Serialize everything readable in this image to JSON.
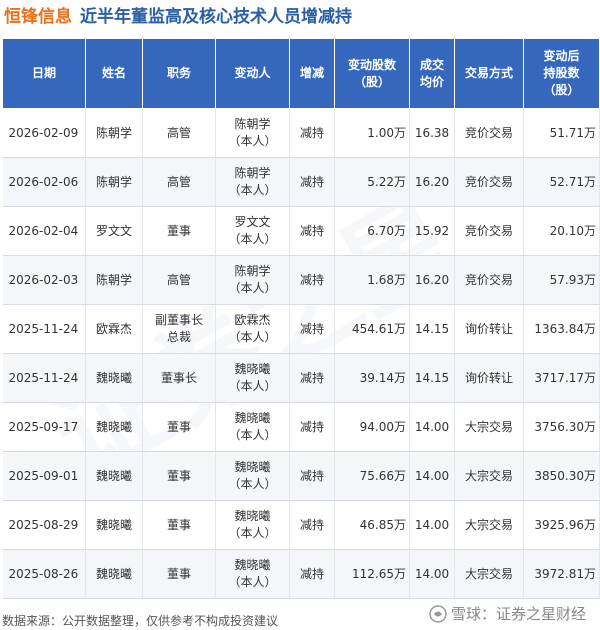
{
  "title": {
    "company": "恒锋信息",
    "text": "近半年董监高及核心技术人员增减持"
  },
  "table": {
    "headers": {
      "date": "日期",
      "name": "姓名",
      "role": "职务",
      "changer": "变动人",
      "change": "增减",
      "amount": "变动股数\n（股）",
      "price": "成交\n均价",
      "method": "交易方式",
      "after": "变动后\n持股数\n（股）"
    },
    "rows": [
      {
        "date": "2026-02-09",
        "name": "陈朝学",
        "role": "高管",
        "changer": "陈朝学\n（本人）",
        "change": "减持",
        "amount": "1.00万",
        "price": "16.38",
        "method": "竞价交易",
        "after": "51.71万"
      },
      {
        "date": "2026-02-06",
        "name": "陈朝学",
        "role": "高管",
        "changer": "陈朝学\n（本人）",
        "change": "减持",
        "amount": "5.22万",
        "price": "16.20",
        "method": "竞价交易",
        "after": "52.71万"
      },
      {
        "date": "2026-02-04",
        "name": "罗文文",
        "role": "董事",
        "changer": "罗文文\n（本人）",
        "change": "减持",
        "amount": "6.70万",
        "price": "15.92",
        "method": "竞价交易",
        "after": "20.10万"
      },
      {
        "date": "2026-02-03",
        "name": "陈朝学",
        "role": "高管",
        "changer": "陈朝学\n（本人）",
        "change": "减持",
        "amount": "1.68万",
        "price": "16.20",
        "method": "竞价交易",
        "after": "57.93万"
      },
      {
        "date": "2025-11-24",
        "name": "欧霖杰",
        "role": "副董事长\n总裁",
        "changer": "欧霖杰\n（本人）",
        "change": "减持",
        "amount": "454.61万",
        "price": "14.15",
        "method": "询价转让",
        "after": "1363.84万"
      },
      {
        "date": "2025-11-24",
        "name": "魏晓曦",
        "role": "董事长",
        "changer": "魏晓曦\n（本人）",
        "change": "减持",
        "amount": "39.14万",
        "price": "14.15",
        "method": "询价转让",
        "after": "3717.17万"
      },
      {
        "date": "2025-09-17",
        "name": "魏晓曦",
        "role": "董事",
        "changer": "魏晓曦\n（本人）",
        "change": "减持",
        "amount": "94.00万",
        "price": "14.00",
        "method": "大宗交易",
        "after": "3756.30万"
      },
      {
        "date": "2025-09-01",
        "name": "魏晓曦",
        "role": "董事",
        "changer": "魏晓曦\n（本人）",
        "change": "减持",
        "amount": "75.66万",
        "price": "14.00",
        "method": "大宗交易",
        "after": "3850.30万"
      },
      {
        "date": "2025-08-29",
        "name": "魏晓曦",
        "role": "董事",
        "changer": "魏晓曦\n（本人）",
        "change": "减持",
        "amount": "46.85万",
        "price": "14.00",
        "method": "大宗交易",
        "after": "3925.96万"
      },
      {
        "date": "2025-08-26",
        "name": "魏晓曦",
        "role": "董事",
        "changer": "魏晓曦\n（本人）",
        "change": "减持",
        "amount": "112.65万",
        "price": "14.00",
        "method": "大宗交易",
        "after": "3972.81万"
      }
    ]
  },
  "footer": {
    "source": "数据来源：公开数据整理，仅供参考不构成投资建议",
    "brand": "雪球：证券之星财经"
  },
  "watermark": {
    "text": "证券之星"
  },
  "colors": {
    "header_bg": "#3568bd",
    "company": "#e8731c",
    "title": "#2a5fa8",
    "decrease": "#2e9b3b"
  },
  "icons": {
    "brand": "snowball-icon"
  }
}
